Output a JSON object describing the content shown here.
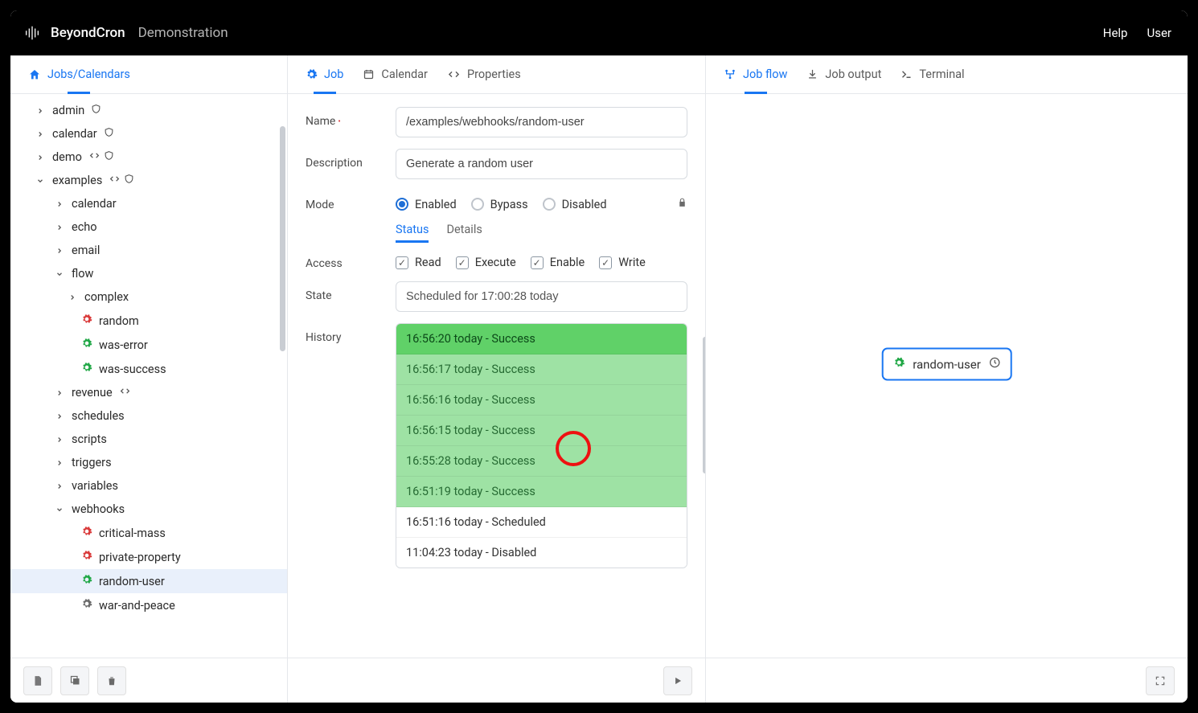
{
  "brand": {
    "name": "BeyondCron",
    "env": "Demonstration"
  },
  "topbar": {
    "help": "Help",
    "user": "User"
  },
  "sidebar": {
    "header": "Jobs/Calendars",
    "tree": [
      {
        "depth": 1,
        "expanded": false,
        "label": "admin",
        "icons": [
          "shield"
        ]
      },
      {
        "depth": 1,
        "expanded": false,
        "label": "calendar",
        "icons": [
          "shield"
        ]
      },
      {
        "depth": 1,
        "expanded": false,
        "label": "demo",
        "icons": [
          "code",
          "shield"
        ]
      },
      {
        "depth": 1,
        "expanded": true,
        "label": "examples",
        "icons": [
          "code",
          "shield"
        ]
      },
      {
        "depth": 2,
        "expanded": false,
        "label": "calendar",
        "icons": []
      },
      {
        "depth": 2,
        "expanded": false,
        "label": "echo",
        "icons": []
      },
      {
        "depth": 2,
        "expanded": false,
        "label": "email",
        "icons": []
      },
      {
        "depth": 2,
        "expanded": true,
        "label": "flow",
        "icons": []
      },
      {
        "depth": 3,
        "expanded": false,
        "label": "complex",
        "icons": []
      },
      {
        "depth": 4,
        "leaf": true,
        "gear": "red",
        "label": "random"
      },
      {
        "depth": 4,
        "leaf": true,
        "gear": "green",
        "label": "was-error"
      },
      {
        "depth": 4,
        "leaf": true,
        "gear": "green",
        "label": "was-success"
      },
      {
        "depth": 2,
        "expanded": false,
        "label": "revenue",
        "icons": [
          "code"
        ]
      },
      {
        "depth": 2,
        "expanded": false,
        "label": "schedules",
        "icons": []
      },
      {
        "depth": 2,
        "expanded": false,
        "label": "scripts",
        "icons": []
      },
      {
        "depth": 2,
        "expanded": false,
        "label": "triggers",
        "icons": []
      },
      {
        "depth": 2,
        "expanded": false,
        "label": "variables",
        "icons": []
      },
      {
        "depth": 2,
        "expanded": true,
        "label": "webhooks",
        "icons": []
      },
      {
        "depth": 4,
        "leaf": true,
        "gear": "red",
        "label": "critical-mass"
      },
      {
        "depth": 4,
        "leaf": true,
        "gear": "red",
        "label": "private-property"
      },
      {
        "depth": 4,
        "leaf": true,
        "gear": "green",
        "label": "random-user",
        "selected": true
      },
      {
        "depth": 4,
        "leaf": true,
        "gear": "grey",
        "label": "war-and-peace"
      }
    ]
  },
  "middle": {
    "tabs": [
      "Job",
      "Calendar",
      "Properties"
    ],
    "active_tab": 0,
    "fields": {
      "name_label": "Name",
      "name_value": "/examples/webhooks/random-user",
      "desc_label": "Description",
      "desc_value": "Generate a random user",
      "mode_label": "Mode",
      "mode_options": [
        "Enabled",
        "Bypass",
        "Disabled"
      ],
      "mode_selected": 0,
      "inner_tabs": [
        "Status",
        "Details"
      ],
      "inner_active": 0,
      "access_label": "Access",
      "access_items": [
        "Read",
        "Execute",
        "Enable",
        "Write"
      ],
      "state_label": "State",
      "state_value": "Scheduled for 17:00:28 today",
      "history_label": "History",
      "history": [
        {
          "text": "16:56:20 today - Success",
          "kind": "success-bright"
        },
        {
          "text": "16:56:17 today - Success",
          "kind": "success"
        },
        {
          "text": "16:56:16 today - Success",
          "kind": "success"
        },
        {
          "text": "16:56:15 today - Success",
          "kind": "success"
        },
        {
          "text": "16:55:28 today - Success",
          "kind": "success"
        },
        {
          "text": "16:51:19 today - Success",
          "kind": "success"
        },
        {
          "text": "16:51:16 today - Scheduled",
          "kind": "plain"
        },
        {
          "text": "11:04:23 today - Disabled",
          "kind": "plain"
        }
      ]
    }
  },
  "right": {
    "tabs": [
      "Job flow",
      "Job output",
      "Terminal"
    ],
    "active_tab": 0,
    "node_label": "random-user"
  }
}
